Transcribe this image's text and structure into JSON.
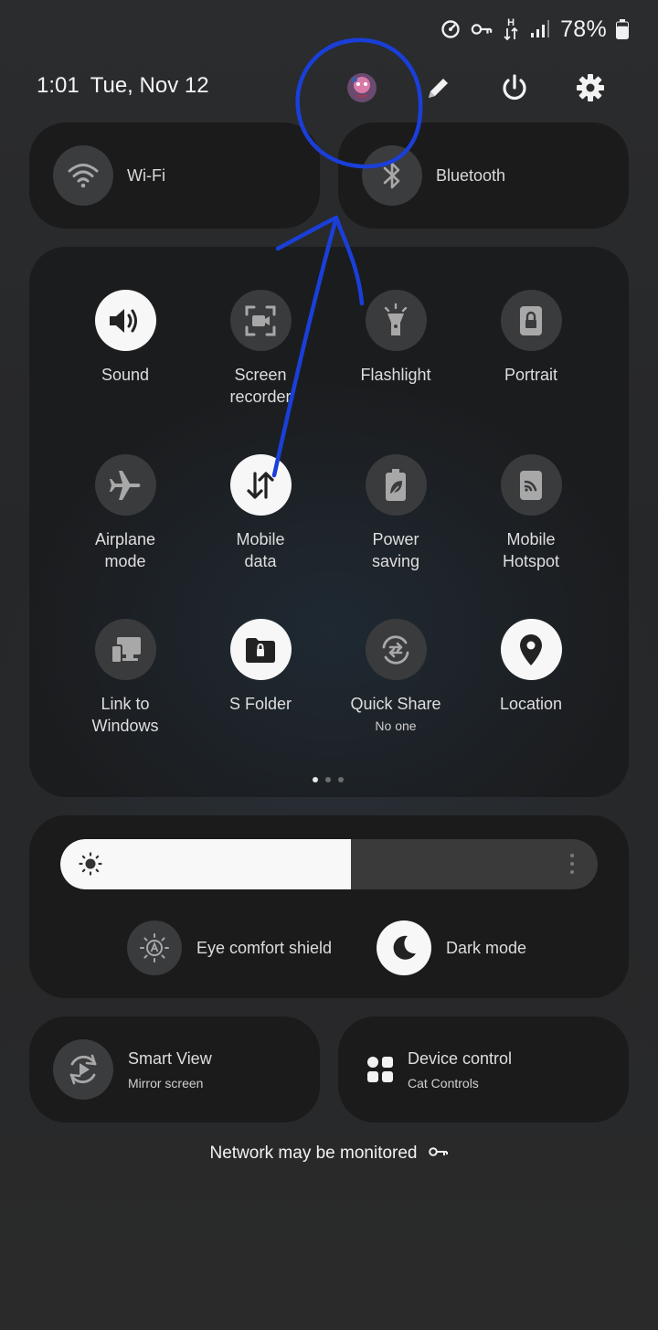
{
  "status_bar": {
    "battery_percent": "78%",
    "battery_level": 0.78,
    "network_type": "H",
    "icons": [
      "data-saver-icon",
      "vpn-key-icon",
      "mobile-data-activity-icon",
      "signal-icon",
      "battery-icon"
    ]
  },
  "header": {
    "time": "1:01",
    "date": "Tue, Nov 12",
    "icons": [
      "profile-avatar",
      "pencil-icon",
      "power-icon",
      "gear-icon"
    ]
  },
  "big_tiles": [
    {
      "label": "Wi-Fi",
      "icon": "wifi-icon",
      "active": false
    },
    {
      "label": "Bluetooth",
      "icon": "bluetooth-icon",
      "active": false
    }
  ],
  "quick_settings": [
    {
      "label": "Sound",
      "icon": "speaker-icon",
      "active": true
    },
    {
      "label": "Screen recorder",
      "icon": "screen-recorder-icon",
      "active": false
    },
    {
      "label": "Flashlight",
      "icon": "flashlight-icon",
      "active": false
    },
    {
      "label": "Portrait",
      "icon": "rotation-lock-icon",
      "active": false
    },
    {
      "label": "Airplane mode",
      "icon": "airplane-icon",
      "active": false
    },
    {
      "label": "Mobile data",
      "icon": "mobile-data-icon",
      "active": true
    },
    {
      "label": "Power saving",
      "icon": "leaf-battery-icon",
      "active": false
    },
    {
      "label": "Mobile Hotspot",
      "icon": "hotspot-icon",
      "active": false
    },
    {
      "label": "Link to Windows",
      "icon": "link-to-windows-icon",
      "active": false
    },
    {
      "label": "S Folder",
      "icon": "secure-folder-icon",
      "active": true
    },
    {
      "label": "Quick Share",
      "sub": "No one",
      "icon": "quick-share-icon",
      "active": false
    },
    {
      "label": "Location",
      "icon": "location-pin-icon",
      "active": true
    }
  ],
  "page_indicator": {
    "pages": 3,
    "current": 1
  },
  "brightness": {
    "level": 0.54
  },
  "toggles": [
    {
      "label": "Eye comfort shield",
      "icon": "eye-comfort-icon",
      "active": false
    },
    {
      "label": "Dark mode",
      "icon": "moon-icon",
      "active": true
    }
  ],
  "bottom_tiles": [
    {
      "title": "Smart View",
      "sub": "Mirror screen",
      "icon": "smart-view-icon"
    },
    {
      "title": "Device control",
      "sub": "Cat Controls",
      "icon": "device-control-icon"
    }
  ],
  "footer": {
    "network_notice": "Network may be monitored",
    "icon": "vpn-key-icon"
  },
  "colors": {
    "annotation": "#1a3fd9",
    "active_tile": "#f7f7f7",
    "inactive_tile": "#3a3b3d",
    "card": "#1b1b1c"
  }
}
